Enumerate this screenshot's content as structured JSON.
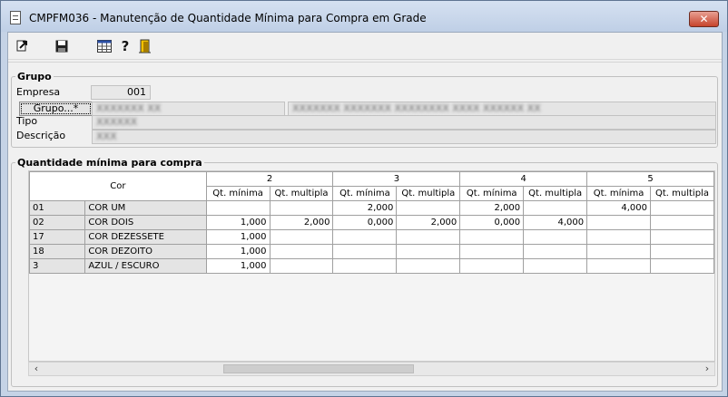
{
  "window": {
    "title": "CMPFM036 - Manutenção de Quantidade Mínima para Compra em Grade",
    "close_label": "✕"
  },
  "toolbar": {
    "icons": [
      "exit-icon",
      "save-icon",
      "grid-icon",
      "help-icon",
      "door-icon"
    ],
    "help_glyph": "?"
  },
  "grupo_section": {
    "legend": "Grupo",
    "empresa_label": "Empresa",
    "empresa_value": "001",
    "empresa_side": "",
    "grupo_button": "Grupo...*",
    "grupo_code": "XXXXXXX XX",
    "grupo_name": "XXXXXXX XXXXXXX XXXXXXXX XXXX XXXXXX XX",
    "tipo_label": "Tipo",
    "tipo_value": "XXXXXX",
    "descricao_label": "Descrição",
    "descricao_value": "XXX"
  },
  "qtd_section": {
    "legend": "Quantidade mínima para compra",
    "cor_header": "Cor",
    "size_groups": [
      "2",
      "3",
      "4",
      "5"
    ],
    "sub_headers": [
      "Qt. mínima",
      "Qt. multipla"
    ],
    "rows": [
      {
        "code": "01",
        "name": "COR UM",
        "values": [
          "",
          "",
          "2,000",
          "",
          "2,000",
          "",
          "4,000",
          ""
        ]
      },
      {
        "code": "02",
        "name": "COR DOIS",
        "values": [
          "1,000",
          "2,000",
          "0,000",
          "2,000",
          "0,000",
          "4,000",
          "",
          ""
        ]
      },
      {
        "code": "17",
        "name": "COR DEZESSETE",
        "values": [
          "1,000",
          "",
          "",
          "",
          "",
          "",
          "",
          ""
        ]
      },
      {
        "code": "18",
        "name": "COR DEZOITO",
        "values": [
          "1,000",
          "",
          "",
          "",
          "",
          "",
          "",
          ""
        ]
      },
      {
        "code": "3",
        "name": "AZUL / ESCURO",
        "values": [
          "1,000",
          "",
          "",
          "",
          "",
          "",
          "",
          ""
        ]
      }
    ]
  },
  "scrollbar": {
    "left_arrow": "‹",
    "right_arrow": "›"
  },
  "colors": {
    "titlebar": "#c5d3e6",
    "close_button": "#c7432b"
  }
}
